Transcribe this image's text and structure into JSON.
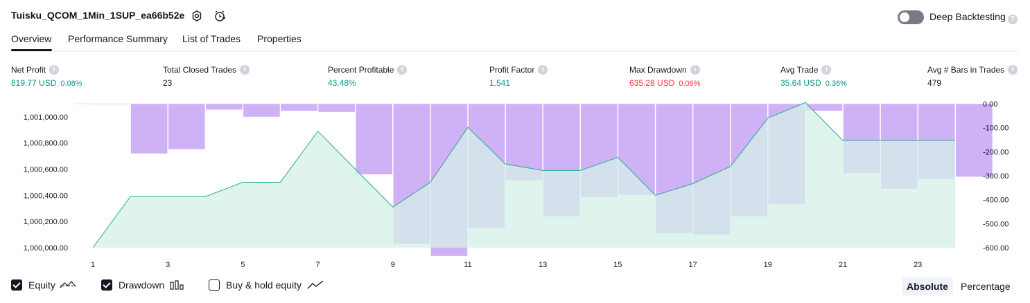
{
  "header": {
    "strategy_name": "Tuisku_QCOM_1Min_1SUP_ea66b52e",
    "settings_icon": "settings-icon",
    "add_alert_icon": "add-alert-icon",
    "deep_backtesting_label": "Deep Backtesting",
    "deep_backtesting_enabled": false,
    "help_icon": "question-icon"
  },
  "tabs": [
    {
      "label": "Overview",
      "active": true
    },
    {
      "label": "Performance Summary",
      "active": false
    },
    {
      "label": "List of Trades",
      "active": false
    },
    {
      "label": "Properties",
      "active": false
    }
  ],
  "metrics": [
    {
      "label": "Net Profit",
      "value": "819.77 USD",
      "pct": "0.08%",
      "color": "#089981"
    },
    {
      "label": "Total Closed Trades",
      "value": "23",
      "pct": "",
      "color": "#131722"
    },
    {
      "label": "Percent Profitable",
      "value": "43.48%",
      "pct": "",
      "color": "#089981"
    },
    {
      "label": "Profit Factor",
      "value": "1.541",
      "pct": "",
      "color": "#089981"
    },
    {
      "label": "Max Drawdown",
      "value": "635.28 USD",
      "pct": "0.06%",
      "color": "#f23645"
    },
    {
      "label": "Avg Trade",
      "value": "35.64 USD",
      "pct": "0.36%",
      "color": "#089981"
    },
    {
      "label": "Avg # Bars in Trades",
      "value": "479",
      "pct": "",
      "color": "#131722"
    }
  ],
  "chart_data": {
    "type": "area",
    "x": [
      1,
      2,
      3,
      4,
      5,
      6,
      7,
      8,
      9,
      10,
      11,
      12,
      13,
      14,
      15,
      16,
      17,
      18,
      19,
      20,
      21,
      22,
      23,
      24
    ],
    "x_tick_labels": [
      "1",
      "3",
      "5",
      "7",
      "9",
      "11",
      "13",
      "15",
      "17",
      "19",
      "21",
      "23"
    ],
    "series": [
      {
        "name": "Equity",
        "type": "area",
        "axis": "left",
        "values": [
          1000000,
          1000390,
          1000390,
          1000390,
          1000500,
          1000500,
          1000890,
          1000600,
          1000310,
          1000500,
          1000920,
          1000640,
          1000590,
          1000590,
          1000690,
          1000400,
          1000490,
          1000620,
          1000990,
          1001110,
          1000820,
          1000820,
          1000820,
          1000820
        ]
      },
      {
        "name": "Drawdown",
        "type": "bar",
        "axis": "right",
        "values": [
          -2,
          -208,
          -190,
          -25,
          -55,
          -30,
          -35,
          -295,
          -585,
          -635,
          -520,
          -320,
          -470,
          -390,
          -380,
          -540,
          -545,
          -470,
          -420,
          -30,
          -290,
          -355,
          -315,
          -305
        ]
      }
    ],
    "left_axis": {
      "ticks": [
        "1,000,000.00",
        "1,000,200.00",
        "1,000,400.00",
        "1,000,600.00",
        "1,000,800.00",
        "1,001,000.00"
      ],
      "range": [
        1000000,
        1001100
      ]
    },
    "right_axis": {
      "ticks": [
        "0.00",
        "-100.00",
        "-200.00",
        "-300.00",
        "-400.00",
        "-500.00",
        "-600.00"
      ],
      "range": [
        0,
        -600
      ]
    },
    "colors": {
      "equity_line": "#22ab94",
      "equity_fill": "#d5f0e8",
      "drawdown_fill": "#c7a3f5"
    }
  },
  "legend": {
    "items": [
      {
        "label": "Equity",
        "checked": true,
        "icon": "equity-line-icon"
      },
      {
        "label": "Drawdown",
        "checked": true,
        "icon": "drawdown-bars-icon"
      },
      {
        "label": "Buy & hold equity",
        "checked": false,
        "icon": "buy-hold-line-icon"
      }
    ],
    "modes": [
      {
        "label": "Absolute",
        "active": true
      },
      {
        "label": "Percentage",
        "active": false
      }
    ]
  }
}
